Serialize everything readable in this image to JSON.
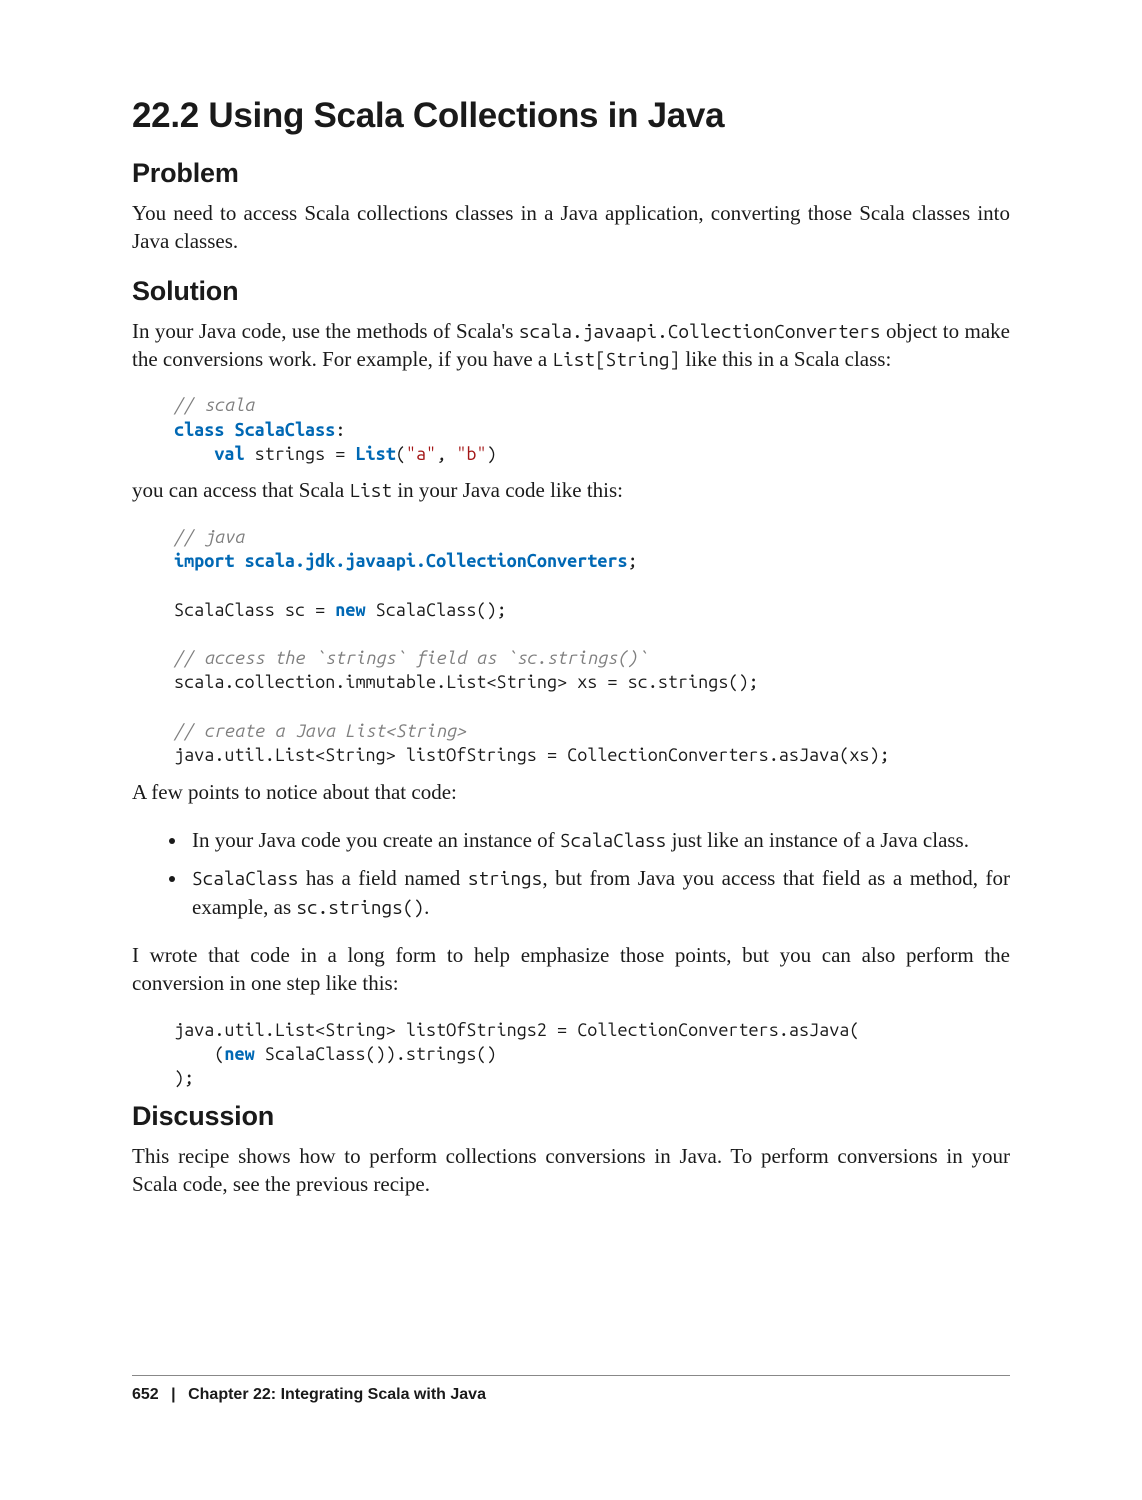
{
  "title": "22.2 Using Scala Collections in Java",
  "sections": {
    "problem": {
      "heading": "Problem",
      "para1_a": "You need to access Scala collections classes in a Java application, converting those Scala classes into Java classes."
    },
    "solution": {
      "heading": "Solution",
      "p1_a": "In your Java code, use the methods of Scala's ",
      "p1_code1": "scala.javaapi.CollectionConverters",
      "p1_b": " object to make the conversions work. For example, if you have a ",
      "p1_code2": "List[String]",
      "p1_c": " like this in a Scala class:",
      "code1": {
        "c1": "// scala",
        "kw_class": "class",
        "clsname": "ScalaClass",
        "colon": ":",
        "kw_val": "val",
        "field": " strings = ",
        "kw_list": "List",
        "lp": "(",
        "s1": "\"a\"",
        "comma": ", ",
        "s2": "\"b\"",
        "rp": ")"
      },
      "p2_a": "you can access that Scala ",
      "p2_code1": "List",
      "p2_b": " in your Java code like this:",
      "code2": {
        "c1": "// java",
        "kw_import": "import",
        "pkg": "scala.jdk.javaapi.CollectionConverters",
        "semi": ";",
        "l3a": "ScalaClass sc = ",
        "kw_new": "new",
        "l3b": " ScalaClass();",
        "c2": "// access the `strings` field as `sc.strings()`",
        "l5": "scala.collection.immutable.List<String> xs = sc.strings();",
        "c3": "// create a Java List<String>",
        "l7": "java.util.List<String> listOfStrings = CollectionConverters.asJava(xs);"
      },
      "p3": "A few points to notice about that code:",
      "bullets": {
        "b1_a": "In your Java code you create an instance of ",
        "b1_code": "ScalaClass",
        "b1_b": " just like an instance of a Java class.",
        "b2_code1": "ScalaClass",
        "b2_a": " has a field named ",
        "b2_code2": "strings",
        "b2_b": ", but from Java you access that field as a method, for example, as ",
        "b2_code3": "sc.strings()",
        "b2_c": "."
      },
      "p4": "I wrote that code in a long form to help emphasize those points, but you can also perform the conversion in one step like this:",
      "code3": {
        "l1": "java.util.List<String> listOfStrings2 = CollectionConverters.asJava(",
        "indent": "    (",
        "kw_new": "new",
        "l2b": " ScalaClass()).strings()",
        "l3": ");"
      }
    },
    "discussion": {
      "heading": "Discussion",
      "p1": "This recipe shows how to perform collections conversions in Java. To perform conversions in your Scala code, see the previous recipe."
    }
  },
  "footer": {
    "page": "652",
    "sep": "|",
    "chapter": "Chapter 22: Integrating Scala with Java"
  }
}
